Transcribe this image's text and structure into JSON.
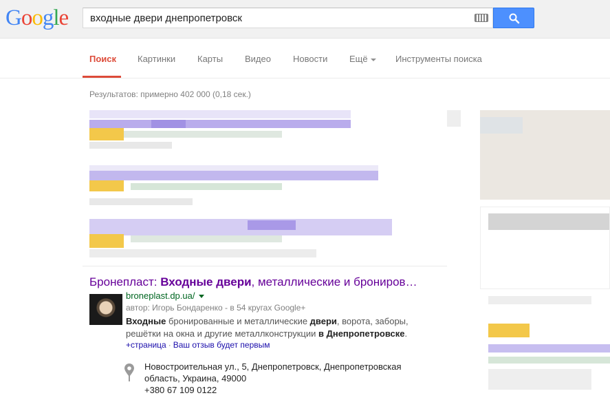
{
  "logo": [
    "G",
    "o",
    "o",
    "g",
    "l",
    "e"
  ],
  "search": {
    "query": "входные двери днепропетровск",
    "keyboard_icon": "keyboard-icon",
    "search_icon": "search-icon"
  },
  "tabs": [
    {
      "label": "Поиск",
      "active": true
    },
    {
      "label": "Картинки"
    },
    {
      "label": "Карты"
    },
    {
      "label": "Видео"
    },
    {
      "label": "Новости"
    },
    {
      "label": "Ещё"
    },
    {
      "label": "Инструменты поиска"
    }
  ],
  "stats": "Результатов: примерно 402 000 (0,18 сек.)",
  "result": {
    "title_part1": "Бронепласт: ",
    "title_bold": "Входные двери",
    "title_part2": ", металлические и брониров…",
    "url": "broneplast.dp.ua/",
    "author": "автор: Игорь Бондаренко - в 54 кругах Google+",
    "snippet_b1": "Входные",
    "snippet_t1": " бронированные и металлические ",
    "snippet_b2": "двери",
    "snippet_t2": ", ворота, заборы, решётки на окна и другие металлконструкции ",
    "snippet_b3": "в Днепропетровске",
    "snippet_t3": ".",
    "link_page": "+страница",
    "link_sep": "·",
    "link_review": "Ваш отзыв будет первым",
    "address_line1": "Новостроительная ул., 5, Днепропетровск, Днепропетровская",
    "address_line2": "область, Украина, 49000",
    "phone": "+380 67 109 0122"
  },
  "colors": {
    "accent_red": "#dd4b39",
    "button_blue": "#4d90fe",
    "visited_purple": "#660099",
    "url_green": "#006621"
  }
}
